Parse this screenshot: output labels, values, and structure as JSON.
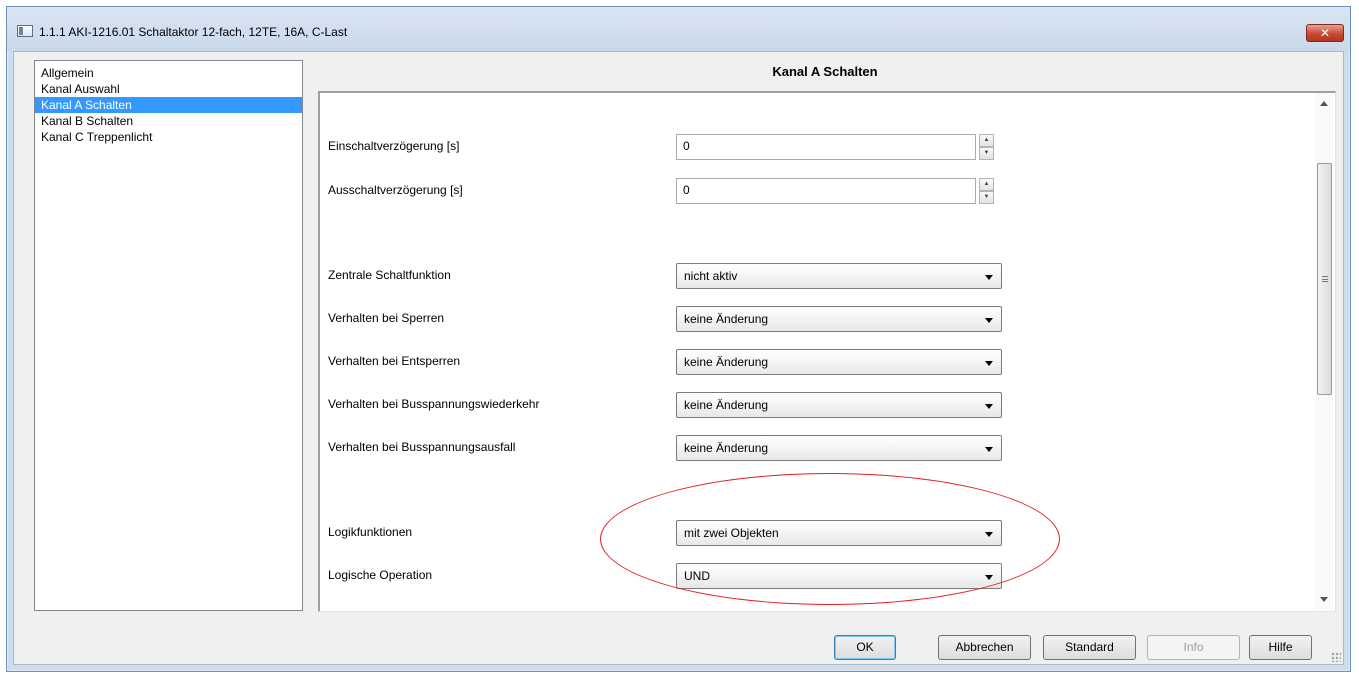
{
  "window": {
    "title": "1.1.1 AKI-1216.01 Schaltaktor 12-fach, 12TE, 16A, C-Last",
    "close_label": "✕"
  },
  "sidebar": {
    "items": [
      {
        "label": "Allgemein",
        "selected": false
      },
      {
        "label": "Kanal Auswahl",
        "selected": false
      },
      {
        "label": "Kanal A Schalten",
        "selected": true
      },
      {
        "label": "Kanal B Schalten",
        "selected": false
      },
      {
        "label": "Kanal C Treppenlicht",
        "selected": false
      }
    ]
  },
  "panel": {
    "title": "Kanal A Schalten",
    "spinners": [
      {
        "label": "Einschaltverzögerung [s]",
        "value": "0"
      },
      {
        "label": "Ausschaltverzögerung [s]",
        "value": "0"
      }
    ],
    "dropdowns": [
      {
        "label": "Zentrale Schaltfunktion",
        "value": "nicht aktiv"
      },
      {
        "label": "Verhalten bei Sperren",
        "value": "keine Änderung"
      },
      {
        "label": "Verhalten bei Entsperren",
        "value": "keine Änderung"
      },
      {
        "label": "Verhalten bei Busspannungswiederkehr",
        "value": "keine Änderung"
      },
      {
        "label": "Verhalten bei Busspannungsausfall",
        "value": "keine Änderung"
      },
      {
        "label": "Logikfunktionen",
        "value": "mit zwei Objekten"
      },
      {
        "label": "Logische Operation",
        "value": "UND"
      }
    ]
  },
  "buttons": {
    "ok": "OK",
    "cancel": "Abbrechen",
    "standard": "Standard",
    "info": "Info",
    "help": "Hilfe"
  },
  "colors": {
    "selection": "#3399ff",
    "annotation_ellipse": "#e31b23",
    "close_button": "#c84a34"
  }
}
